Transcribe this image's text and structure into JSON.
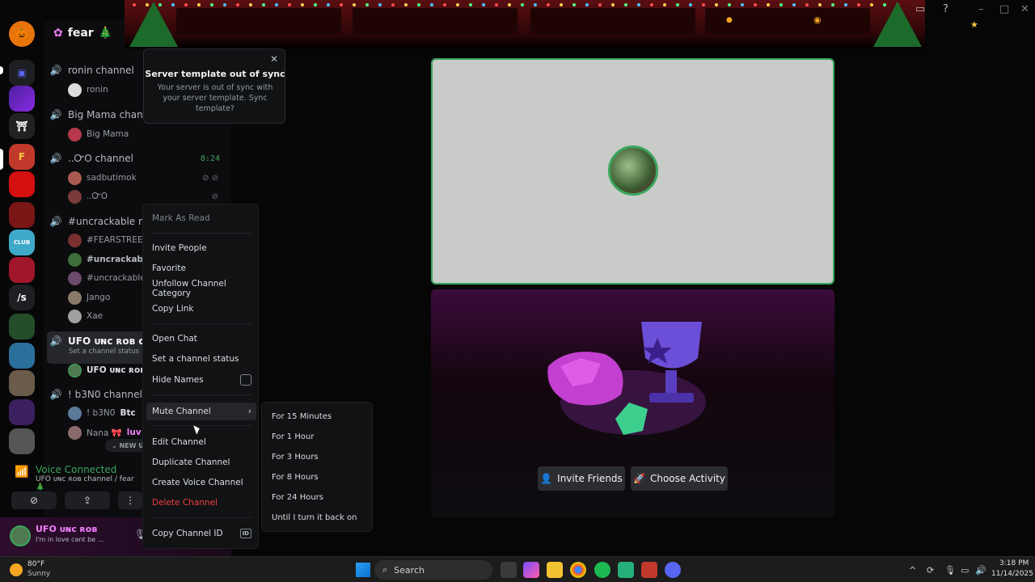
{
  "server": {
    "name": "fear",
    "tree_emoji": "🎄"
  },
  "channels": [
    {
      "name": "ronin channel",
      "users": [
        {
          "name": "ronin",
          "color": "#6d6f78"
        }
      ]
    },
    {
      "name": "Big Mama channel",
      "users": [
        {
          "name": "Big Mama",
          "color": "#b5384b"
        }
      ]
    },
    {
      "name": "..ᏅO channel",
      "time": "8:24",
      "users": [
        {
          "name": "sadbutimok",
          "color": "#a85a4f"
        },
        {
          "name": "..ᏅO",
          "color": "#7a3b3b"
        }
      ]
    },
    {
      "name": "#uncrackable run",
      "users": [
        {
          "name": "#FEARSTREET",
          "color": "#7a3030"
        },
        {
          "name": "#uncrackable",
          "color": "#3c6e3c"
        },
        {
          "name": "#uncrackable v",
          "color": "#6d4b6d"
        },
        {
          "name": "Jango",
          "color": "#8a7a6a"
        },
        {
          "name": "Xae",
          "color": "#a0a0a0"
        }
      ]
    },
    {
      "name": "UFO ᴜɴᴄ ʀᴏʙ chan",
      "status": "Set a channel status",
      "users": [
        {
          "name": "UFO ᴜɴᴄ ʀᴏʙ",
          "color": "#4f7a4f"
        }
      ]
    },
    {
      "name": "! b3N0 channel",
      "users": [
        {
          "name": "! b3N0",
          "tag": "Btc",
          "color": "#5a7a9a"
        },
        {
          "name": "Nana 🎀",
          "tag": "luv",
          "color": "#8a6a6a"
        }
      ]
    }
  ],
  "new_unreads": "⌄ NEW UN",
  "voice": {
    "status": "Voice Connected",
    "sub": "UFO ᴜɴᴄ ʀᴏʙ channel / fear 🎄"
  },
  "user_bar": {
    "name": "UFO ᴜɴᴄ ʀᴏʙ",
    "status": "I'm in love cant be ..."
  },
  "template_popup": {
    "title": "Server template out of sync",
    "body": "Your server is out of sync with your server template. Sync template?",
    "close": "✕"
  },
  "context_menu": {
    "mark_as_read": "Mark As Read",
    "invite_people": "Invite People",
    "favorite": "Favorite",
    "unfollow": "Unfollow Channel Category",
    "copy_link": "Copy Link",
    "open_chat": "Open Chat",
    "set_status": "Set a channel status",
    "hide_names": "Hide Names",
    "mute_channel": "Mute Channel",
    "edit_channel": "Edit Channel",
    "duplicate_channel": "Duplicate Channel",
    "create_voice_channel": "Create Voice Channel",
    "delete_channel": "Delete Channel",
    "copy_channel_id": "Copy Channel ID",
    "id_badge": "ID"
  },
  "mute_submenu": [
    "For 15 Minutes",
    "For 1 Hour",
    "For 3 Hours",
    "For 8 Hours",
    "For 24 Hours",
    "Until I turn it back on"
  ],
  "activity": {
    "invite_label": "Invite Friends",
    "choose_label": "Choose Activity"
  },
  "taskbar": {
    "weather_temp": "80°F",
    "weather_desc": "Sunny",
    "search": "Search",
    "time": "3:18 PM",
    "date": "11/14/2025"
  },
  "colors": {
    "green": "#3ba55d",
    "danger": "#f23f43",
    "accent": "#5865f2"
  }
}
